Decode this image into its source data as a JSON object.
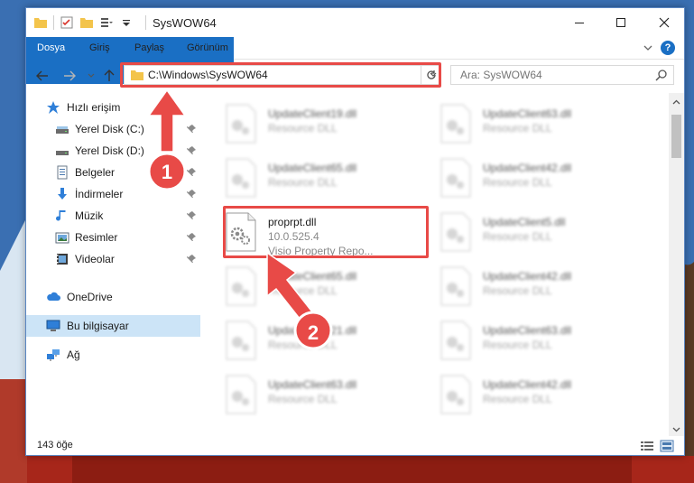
{
  "window": {
    "title": "SysWOW64",
    "controls": {
      "minimize": "minimize-icon",
      "maximize": "maximize-icon",
      "close": "close-icon"
    }
  },
  "ribbon": {
    "tabs": [
      {
        "label": "Dosya",
        "active": true
      },
      {
        "label": "Giriş"
      },
      {
        "label": "Paylaş"
      },
      {
        "label": "Görünüm"
      }
    ],
    "help": "?"
  },
  "navigation": {
    "path": "C:\\Windows\\SysWOW64",
    "search_placeholder": "Ara: SysWOW64"
  },
  "sidebar": {
    "items": [
      {
        "label": "Hızlı erişim",
        "icon": "star-icon",
        "pinned": false
      },
      {
        "label": "Yerel Disk (C:)",
        "icon": "drive-icon",
        "pinned": true
      },
      {
        "label": "Yerel Disk (D:)",
        "icon": "drive-icon",
        "pinned": true
      },
      {
        "label": "Belgeler",
        "icon": "documents-icon",
        "pinned": true
      },
      {
        "label": "İndirmeler",
        "icon": "download-icon",
        "pinned": true
      },
      {
        "label": "Müzik",
        "icon": "music-icon",
        "pinned": true
      },
      {
        "label": "Resimler",
        "icon": "pictures-icon",
        "pinned": true
      },
      {
        "label": "Videolar",
        "icon": "videos-icon",
        "pinned": true
      },
      {
        "label": "OneDrive",
        "icon": "cloud-icon",
        "pinned": false
      },
      {
        "label": "Bu bilgisayar",
        "icon": "computer-icon",
        "selected": true
      },
      {
        "label": "Ağ",
        "icon": "network-icon",
        "pinned": false
      }
    ]
  },
  "files": {
    "left": [
      {
        "name": "UpdateClient19.dll",
        "desc": "Resource DLL"
      },
      {
        "name": "UpdateClient65.dll",
        "desc": "Resource DLL"
      },
      {
        "name": "proprpt.dll",
        "version": "10.0.525.4",
        "desc": "Visio Property Repo..."
      },
      {
        "name": "UpdateClient65.dll",
        "desc": "Resource DLL"
      },
      {
        "name": "UpdateClient21.dll",
        "desc": "Resource DLL"
      },
      {
        "name": "UpdateClient63.dll",
        "desc": "Resource DLL"
      }
    ],
    "right": [
      {
        "name": "UpdateClient63.dll",
        "desc": "Resource DLL"
      },
      {
        "name": "UpdateClient42.dll",
        "desc": "Resource DLL"
      },
      {
        "name": "UpdateClient5.dll",
        "desc": "Resource DLL"
      },
      {
        "name": "UpdateClient42.dll",
        "desc": "Resource DLL"
      },
      {
        "name": "UpdateClient63.dll",
        "desc": "Resource DLL"
      },
      {
        "name": "UpdateClient42.dll",
        "desc": "Resource DLL"
      }
    ]
  },
  "status": {
    "count": "143 öğe"
  },
  "callouts": [
    {
      "number": "1"
    },
    {
      "number": "2"
    }
  ],
  "colors": {
    "accent": "#1a6fc4",
    "highlight": "#e84a47",
    "selection": "#cce4f7"
  }
}
